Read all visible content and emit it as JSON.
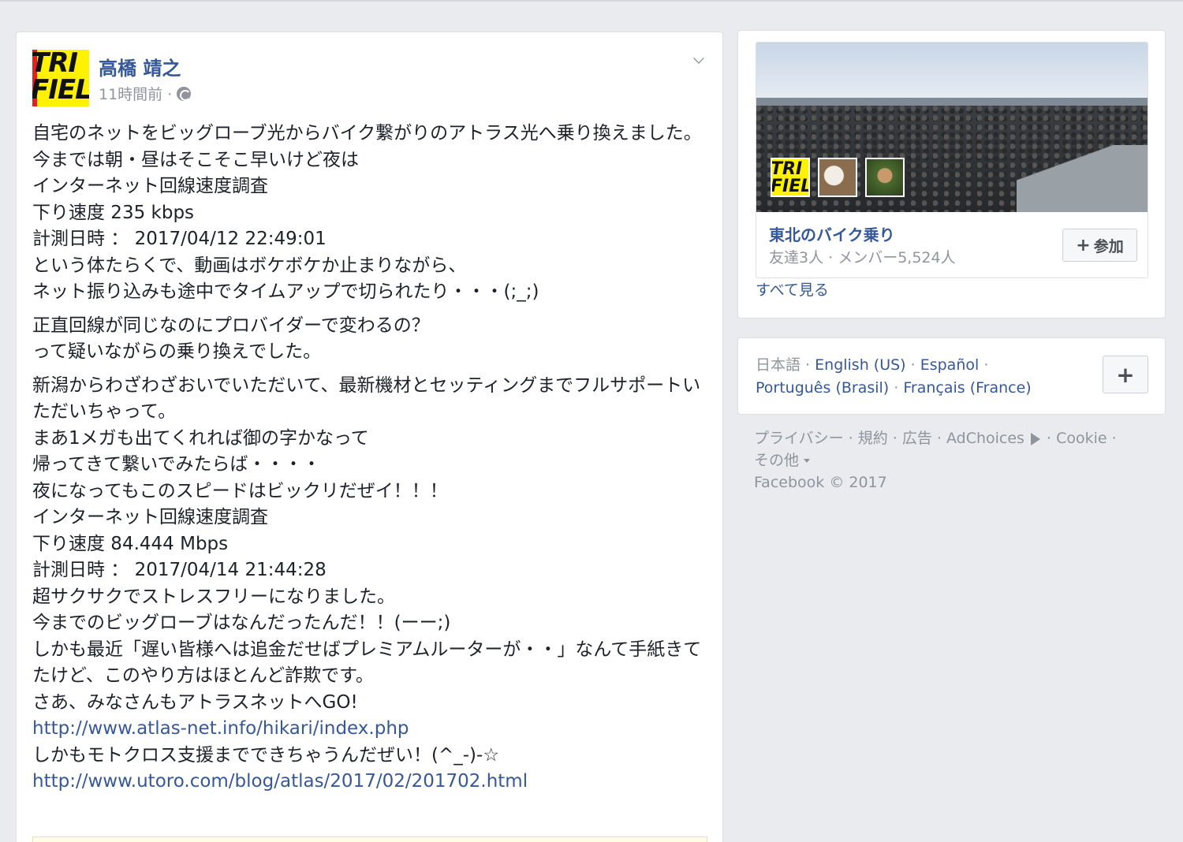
{
  "post": {
    "author": "高橋 靖之",
    "time": "11時間前 ·",
    "avatar_lines": [
      "TRI",
      "FIEL"
    ],
    "paragraphs": [
      {
        "lines": [
          {
            "text": "自宅のネットをビッグローブ光からバイク繋がりのアトラス光へ乗り換えました。",
            "wrap": true
          },
          {
            "text": "今までは朝・昼はそこそこ早いけど夜は"
          },
          {
            "text": "インターネット回線速度調査"
          },
          {
            "text": "下り速度 235 kbps"
          },
          {
            "text": "計測日時 ： 2017/04/12 22:49:01"
          },
          {
            "text": "という体たらくで、動画はボケボケか止まりながら、"
          },
          {
            "text": "ネット振り込みも途中でタイムアップで切られたり・・・(;_;)"
          }
        ]
      },
      {
        "lines": [
          {
            "text": "正直回線が同じなのにプロバイダーで変わるの？"
          },
          {
            "text": "って疑いながらの乗り換えでした。"
          }
        ]
      },
      {
        "lines": [
          {
            "text": "新潟からわざわざおいでいただいて、最新機材とセッティングまでフルサポートいただいちゃって。",
            "wrap": true
          },
          {
            "text": "まあ1メガも出てくれれば御の字かなって"
          },
          {
            "text": "帰ってきて繋いでみたらば・・・・"
          },
          {
            "text": "夜になってもこのスピードはビックリだぜイ！！！"
          },
          {
            "text": "インターネット回線速度調査"
          },
          {
            "text": "下り速度 84.444 Mbps"
          },
          {
            "text": "計測日時 ： 2017/04/14 21:44:28"
          },
          {
            "text": "超サクサクでストレスフリーになりました。"
          },
          {
            "text": "今までのビッグローブはなんだったんだ！！(ーー;)"
          },
          {
            "text": "しかも最近「遅い皆様へは追金だせばプレミアムルーターが・・」なんて手紙きてたけど、このやり方はほとんど詐欺です。",
            "wrap": true
          },
          {
            "text": "さあ、みなさんもアトラスネットへGO!"
          },
          {
            "text": "http://www.atlas-net.info/hikari/index.php",
            "link": true
          },
          {
            "text": "しかもモトクロス支援までできちゃうんだぜい！(^_-)-☆"
          },
          {
            "text": "http://www.utoro.com/blog/atlas/2017/02/201702.html",
            "link": true
          }
        ]
      }
    ]
  },
  "group": {
    "name": "東北のバイク乗り",
    "stats": "友達3人 · メンバー5,524人",
    "join_label": "参加",
    "join_icon": "plus-icon",
    "thumb1_lines": [
      "TRI",
      "FIEL"
    ],
    "see_all": "すべて見る"
  },
  "languages": {
    "current": "日本語 ·",
    "items": [
      "English (US)",
      "Español",
      "Português (Brasil)",
      "Français (France)"
    ],
    "add_label": "+"
  },
  "footer": {
    "links_row1": "プライバシー · 規約 · 広告 · AdChoices",
    "links_row1_tail": "· Cookie ·",
    "more": "その他",
    "copyright": "Facebook © 2017"
  },
  "colors": {
    "link": "#365899",
    "muted": "#90949c",
    "background": "#e9ebee"
  }
}
